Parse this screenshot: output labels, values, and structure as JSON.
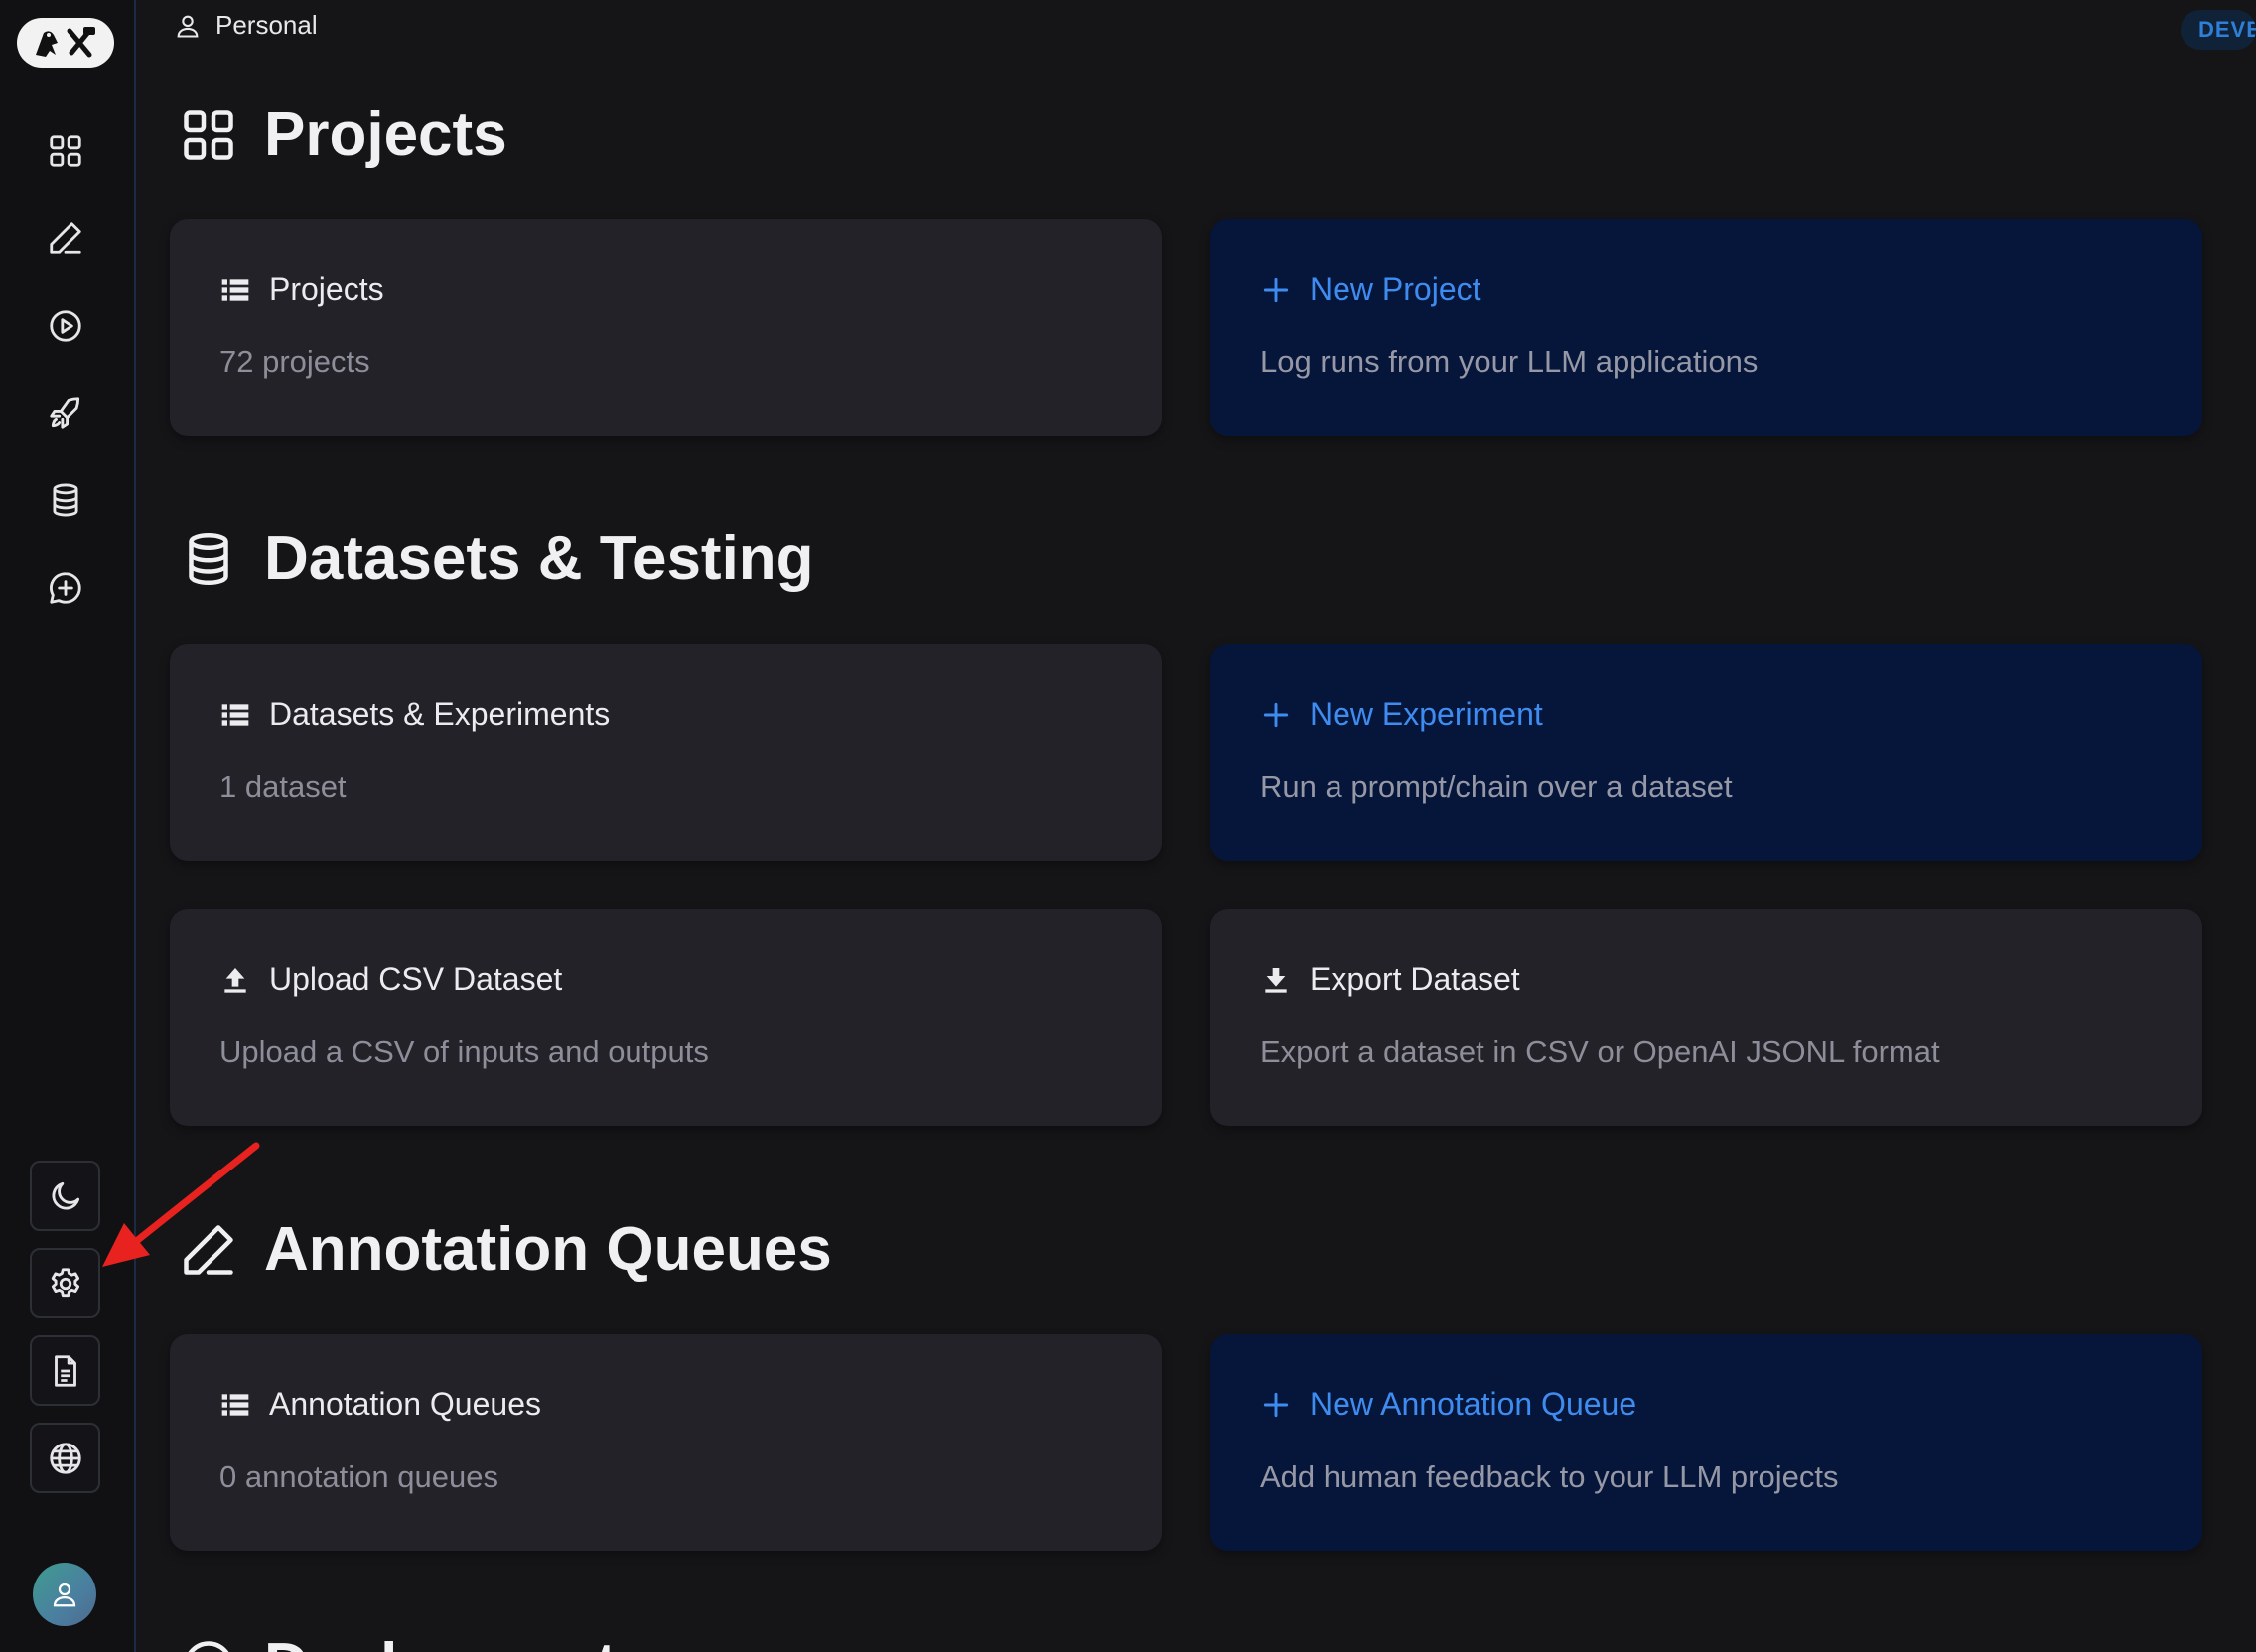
{
  "topbar": {
    "workspace_label": "Personal",
    "environment_badge": "DEVE"
  },
  "sidebar": {
    "nav_icons": [
      "dashboard-icon",
      "pencil-icon",
      "play-circle-icon",
      "rocket-icon",
      "database-icon",
      "chat-plus-icon"
    ],
    "tool_icons": [
      "moon-icon",
      "gear-icon",
      "document-icon",
      "globe-icon"
    ],
    "avatar_icon": "user-icon"
  },
  "sections": {
    "projects": {
      "title": "Projects",
      "card_list": {
        "title": "Projects",
        "subtitle": "72 projects"
      },
      "card_new": {
        "title": "New Project",
        "subtitle": "Log runs from your LLM applications"
      }
    },
    "datasets": {
      "title": "Datasets & Testing",
      "card_list": {
        "title": "Datasets & Experiments",
        "subtitle": "1 dataset"
      },
      "card_new": {
        "title": "New Experiment",
        "subtitle": "Run a prompt/chain over a dataset"
      },
      "card_upload": {
        "title": "Upload CSV Dataset",
        "subtitle": "Upload a CSV of inputs and outputs"
      },
      "card_export": {
        "title": "Export Dataset",
        "subtitle": "Export a dataset in CSV or OpenAI JSONL format"
      }
    },
    "annotation": {
      "title": "Annotation Queues",
      "card_list": {
        "title": "Annotation Queues",
        "subtitle": "0 annotation queues"
      },
      "card_new": {
        "title": "New Annotation Queue",
        "subtitle": "Add human feedback to your LLM projects"
      }
    },
    "next": {
      "title": "Deployments"
    }
  },
  "colors": {
    "background": "#151518",
    "card": "#222228",
    "card_accent": "#06163a",
    "link": "#3f8cf0",
    "annotation_arrow": "#e8221f"
  }
}
